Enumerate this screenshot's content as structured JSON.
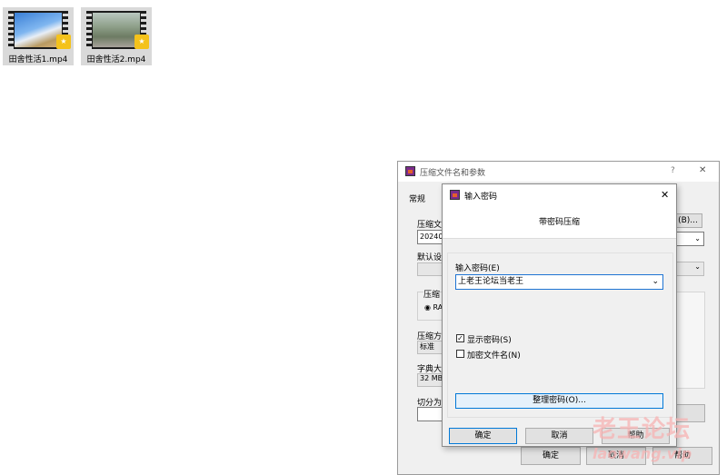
{
  "files": [
    {
      "name": "田舍性活1.mp4",
      "badge": "★"
    },
    {
      "name": "田舍性活2.mp4",
      "badge": "★"
    }
  ],
  "archive_dialog": {
    "title": "压缩文件名和参数",
    "help_symbol": "?",
    "close_symbol": "✕",
    "tab_general": "常规",
    "label_archive_name": "压缩文",
    "archive_name_value": "20240",
    "browse_button": "(B)...",
    "label_default_profile": "默认设",
    "label_archive_format": "压缩",
    "format_rar": "RA",
    "label_method": "压缩方",
    "method_value": "标准",
    "label_dictionary": "字典大",
    "dictionary_value": "32 MB",
    "label_split": "切分为",
    "ok_button": "确定",
    "cancel_button": "取消",
    "help_button": "帮助"
  },
  "password_dialog": {
    "title": "输入密码",
    "close_symbol": "✕",
    "heading": "带密码压缩",
    "label_password": "输入密码(E)",
    "password_value": "上老王论坛当老王",
    "show_password_label": "显示密码(S)",
    "show_password_checked": "✓",
    "encrypt_names_label": "加密文件名(N)",
    "organize_button": "整理密码(O)...",
    "ok_button": "确定",
    "cancel_button": "取消",
    "help_button": "帮助"
  },
  "watermark": {
    "title": "老王论坛",
    "url": "laowang.vip"
  }
}
